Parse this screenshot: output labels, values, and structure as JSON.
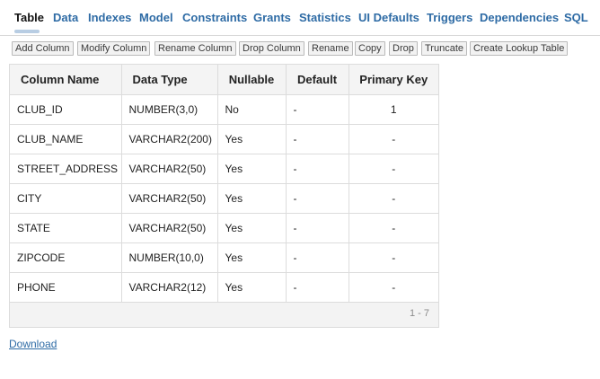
{
  "tabs": [
    {
      "label": "Table",
      "active": true
    },
    {
      "label": "Data"
    },
    {
      "label": "Indexes"
    },
    {
      "label": "Model"
    },
    {
      "label": "Constraints"
    },
    {
      "label": "Grants"
    },
    {
      "label": "Statistics"
    },
    {
      "label": "UI Defaults"
    },
    {
      "label": "Triggers"
    },
    {
      "label": "Dependencies"
    },
    {
      "label": "SQL"
    }
  ],
  "toolbar": {
    "add_column": "Add Column",
    "modify_column": "Modify Column",
    "rename_column": "Rename Column",
    "drop_column": "Drop Column",
    "rename": "Rename",
    "copy": "Copy",
    "drop": "Drop",
    "truncate": "Truncate",
    "create_lookup_table": "Create Lookup Table"
  },
  "table": {
    "headers": [
      "Column Name",
      "Data Type",
      "Nullable",
      "Default",
      "Primary Key"
    ],
    "rows": [
      [
        "CLUB_ID",
        "NUMBER(3,0)",
        "No",
        "-",
        "1"
      ],
      [
        "CLUB_NAME",
        "VARCHAR2(200)",
        "Yes",
        "-",
        "-"
      ],
      [
        "STREET_ADDRESS",
        "VARCHAR2(50)",
        "Yes",
        "-",
        "-"
      ],
      [
        "CITY",
        "VARCHAR2(50)",
        "Yes",
        "-",
        "-"
      ],
      [
        "STATE",
        "VARCHAR2(50)",
        "Yes",
        "-",
        "-"
      ],
      [
        "ZIPCODE",
        "NUMBER(10,0)",
        "Yes",
        "-",
        "-"
      ],
      [
        "PHONE",
        "VARCHAR2(12)",
        "Yes",
        "-",
        "-"
      ]
    ],
    "pagination": "1 - 7"
  },
  "download_label": "Download",
  "colors": {
    "link": "#2e6ba5",
    "active_tab": "#111111",
    "tab_indicator": "#b8cde3",
    "border": "#dcdcdc"
  }
}
